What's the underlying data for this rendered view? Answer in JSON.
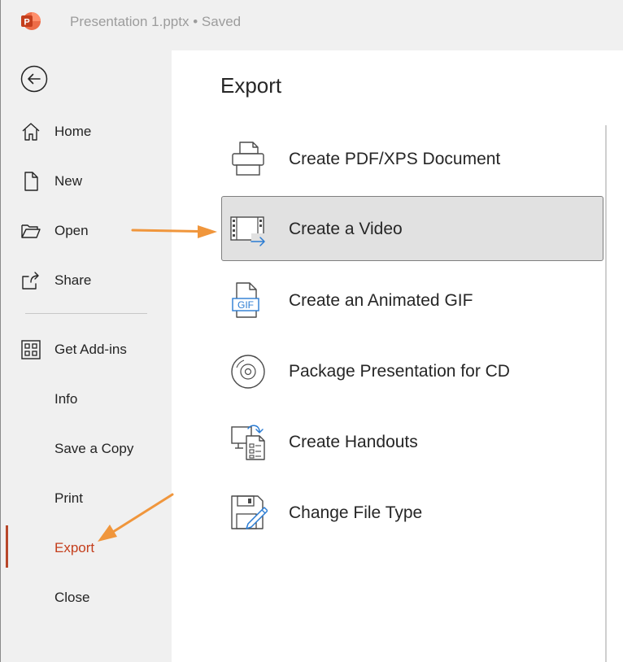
{
  "title_bar": {
    "document_title": "Presentation 1.pptx",
    "separator": "•",
    "status": "Saved"
  },
  "sidebar": {
    "back_icon": "back-arrow-icon",
    "items": [
      {
        "label": "Home",
        "icon": "home-icon"
      },
      {
        "label": "New",
        "icon": "new-document-icon"
      },
      {
        "label": "Open",
        "icon": "open-folder-icon"
      },
      {
        "label": "Share",
        "icon": "share-icon"
      },
      {
        "label": "Get Add-ins",
        "icon": "add-ins-icon"
      },
      {
        "label": "Info"
      },
      {
        "label": "Save a Copy"
      },
      {
        "label": "Print"
      },
      {
        "label": "Export",
        "active": true
      },
      {
        "label": "Close"
      }
    ]
  },
  "main": {
    "title": "Export",
    "options": [
      {
        "label": "Create PDF/XPS Document",
        "icon": "pdf-printer-icon"
      },
      {
        "label": "Create a Video",
        "icon": "video-film-icon",
        "selected": true
      },
      {
        "label": "Create an Animated GIF",
        "icon": "gif-icon",
        "badge": "GIF"
      },
      {
        "label": "Package Presentation for CD",
        "icon": "cd-icon"
      },
      {
        "label": "Create Handouts",
        "icon": "handouts-icon"
      },
      {
        "label": "Change File Type",
        "icon": "change-file-type-icon"
      }
    ]
  },
  "colors": {
    "accent": "#c43e1c",
    "annotation_arrow": "#f0963c",
    "icon_blue": "#2b7cd3"
  }
}
